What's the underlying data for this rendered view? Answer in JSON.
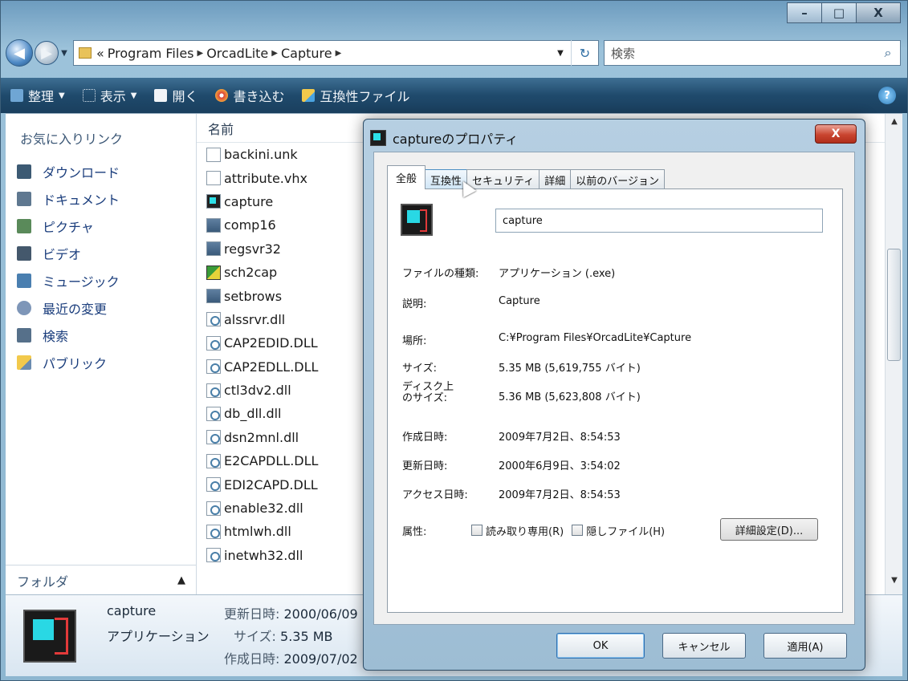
{
  "window": {
    "min_label": "–",
    "max_label": "□",
    "close_label": "X"
  },
  "address": {
    "overflow": "«",
    "crumbs": [
      "Program Files",
      "OrcadLite",
      "Capture"
    ],
    "search_placeholder": "検索"
  },
  "toolbar": {
    "organize": "整理",
    "view": "表示",
    "open": "開く",
    "burn": "書き込む",
    "compat": "互換性ファイル"
  },
  "navpane": {
    "header": "お気に入りリンク",
    "items": [
      "ダウンロード",
      "ドキュメント",
      "ピクチャ",
      "ビデオ",
      "ミュージック",
      "最近の変更",
      "検索",
      "パブリック"
    ],
    "folders_label": "フォルダ"
  },
  "filelist": {
    "column_name": "名前",
    "files": [
      {
        "name": "backini.unk",
        "kind": "file"
      },
      {
        "name": "attribute.vhx",
        "kind": "file"
      },
      {
        "name": "capture",
        "kind": "cap"
      },
      {
        "name": "comp16",
        "kind": "exe"
      },
      {
        "name": "regsvr32",
        "kind": "exe"
      },
      {
        "name": "sch2cap",
        "kind": "sch"
      },
      {
        "name": "setbrows",
        "kind": "exe"
      },
      {
        "name": "alssrvr.dll",
        "kind": "dll"
      },
      {
        "name": "CAP2EDID.DLL",
        "kind": "dll"
      },
      {
        "name": "CAP2EDLL.DLL",
        "kind": "dll"
      },
      {
        "name": "ctl3dv2.dll",
        "kind": "dll"
      },
      {
        "name": "db_dll.dll",
        "kind": "dll"
      },
      {
        "name": "dsn2mnl.dll",
        "kind": "dll"
      },
      {
        "name": "E2CAPDLL.DLL",
        "kind": "dll"
      },
      {
        "name": "EDI2CAPD.DLL",
        "kind": "dll"
      },
      {
        "name": "enable32.dll",
        "kind": "dll"
      },
      {
        "name": "htmlwh.dll",
        "kind": "dll"
      },
      {
        "name": "inetwh32.dll",
        "kind": "dll"
      }
    ]
  },
  "details": {
    "name": "capture",
    "type": "アプリケーション",
    "modified_label": "更新日時:",
    "modified": "2000/06/09",
    "size_label": "サイズ:",
    "size": "5.35 MB",
    "created_label": "作成日時:",
    "created": "2009/07/02"
  },
  "dialog": {
    "title": "captureのプロパティ",
    "close": "X",
    "tabs": [
      "全般",
      "互換性",
      "セキュリティ",
      "詳細",
      "以前のバージョン"
    ],
    "filename": "capture",
    "type_label": "ファイルの種類:",
    "type_value": "アプリケーション (.exe)",
    "desc_label": "説明:",
    "desc_value": "Capture",
    "location_label": "場所:",
    "location_value": "C:¥Program Files¥OrcadLite¥Capture",
    "size_label": "サイズ:",
    "size_value": "5.35 MB (5,619,755 バイト)",
    "disk_label_1": "ディスク上",
    "disk_label_2": "のサイズ:",
    "disk_value": "5.36 MB (5,623,808 バイト)",
    "created_label": "作成日時:",
    "created_value": "2009年7月2日、8:54:53",
    "modified_label": "更新日時:",
    "modified_value": "2000年6月9日、3:54:02",
    "accessed_label": "アクセス日時:",
    "accessed_value": "2009年7月2日、8:54:53",
    "attr_label": "属性:",
    "readonly_label": "読み取り専用(R)",
    "hidden_label": "隠しファイル(H)",
    "advanced_label": "詳細設定(D)...",
    "ok": "OK",
    "cancel": "キャンセル",
    "apply": "適用(A)"
  }
}
